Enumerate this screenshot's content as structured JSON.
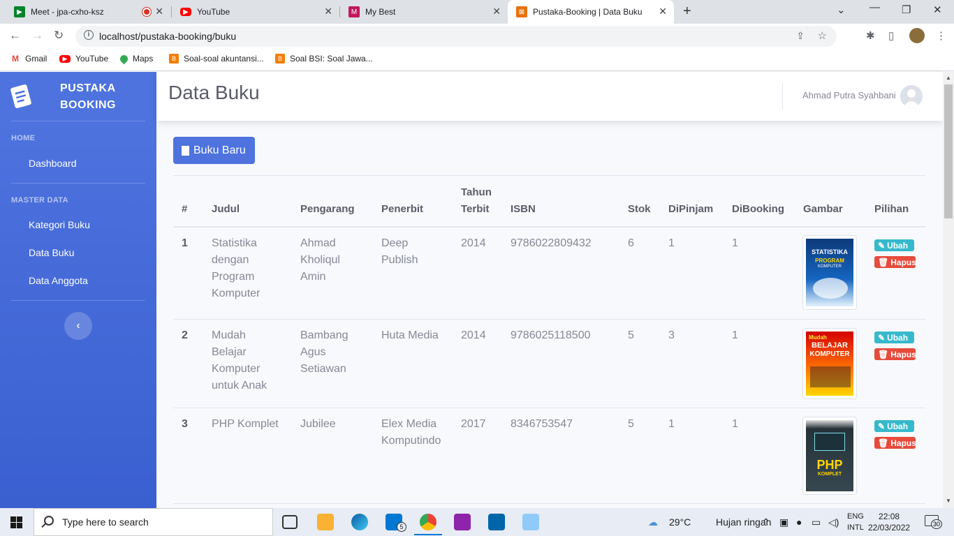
{
  "browser": {
    "tabs": [
      {
        "title": "Meet - jpa-cxho-ksz",
        "favicon": "meet-icon",
        "recording": true
      },
      {
        "title": "YouTube",
        "favicon": "youtube-icon"
      },
      {
        "title": "My Best",
        "favicon": "mybest-icon"
      },
      {
        "title": "Pustaka-Booking | Data Buku",
        "favicon": "pustaka-icon",
        "active": true
      }
    ],
    "url": "localhost/pustaka-booking/buku",
    "bookmarks": [
      {
        "label": "Gmail",
        "icon": "gmail-icon"
      },
      {
        "label": "YouTube",
        "icon": "youtube-icon"
      },
      {
        "label": "Maps",
        "icon": "maps-icon"
      },
      {
        "label": "Soal-soal akuntansi...",
        "icon": "blogger-icon"
      },
      {
        "label": "Soal BSI: Soal Jawa...",
        "icon": "blogger-icon"
      }
    ]
  },
  "sidebar": {
    "brand_line1": "PUSTAKA",
    "brand_line2": "BOOKING",
    "heading_home": "HOME",
    "item_dashboard": "Dashboard",
    "heading_master": "MASTER DATA",
    "item_kategori": "Kategori Buku",
    "item_buku": "Data Buku",
    "item_anggota": "Data Anggota",
    "toggle_icon": "chevron-left-icon"
  },
  "topbar": {
    "page_title": "Data Buku",
    "username": "Ahmad Putra Syahbani"
  },
  "content": {
    "new_button_label": "Buku Baru",
    "columns": {
      "no": "#",
      "judul": "Judul",
      "pengarang": "Pengarang",
      "penerbit": "Penerbit",
      "tahun_line1": "Tahun",
      "tahun_line2": "Terbit",
      "isbn": "ISBN",
      "stok": "Stok",
      "dipinjam": "DiPinjam",
      "dibooking": "DiBooking",
      "gambar": "Gambar",
      "pilihan": "Pilihan"
    },
    "rows": [
      {
        "no": "1",
        "judul": [
          "Statistika",
          "dengan",
          "Program",
          "Komputer"
        ],
        "pengarang": [
          "Ahmad",
          "Kholiqul",
          "Amin"
        ],
        "penerbit": [
          "Deep",
          "Publish"
        ],
        "tahun": "2014",
        "isbn": "9786022809432",
        "stok": "6",
        "dipinjam": "1",
        "dibooking": "1",
        "cover_title": "STATISTIKA",
        "cover_sub": "PROGRAM",
        "cover_sub2": "KOMPUTER"
      },
      {
        "no": "2",
        "judul": [
          "Mudah",
          "Belajar",
          "Komputer",
          "untuk Anak"
        ],
        "pengarang": [
          "Bambang",
          "Agus",
          "Setiawan"
        ],
        "penerbit": [
          "Huta Media"
        ],
        "tahun": "2014",
        "isbn": "9786025118500",
        "stok": "5",
        "dipinjam": "3",
        "dibooking": "1",
        "cover_title": "Mudah",
        "cover_sub": "BELAJAR",
        "cover_sub2": "KOMPUTER"
      },
      {
        "no": "3",
        "judul": [
          "PHP Komplet"
        ],
        "pengarang": [
          "Jubilee"
        ],
        "penerbit": [
          "Elex Media",
          "Komputindo"
        ],
        "tahun": "2017",
        "isbn": "8346753547",
        "stok": "5",
        "dipinjam": "1",
        "dibooking": "1",
        "cover_title": "PHP",
        "cover_sub": "KOMPLET",
        "cover_sub2": ""
      }
    ],
    "action_edit": "Ubah",
    "action_delete": "Hapus"
  },
  "taskbar": {
    "search_placeholder": "Type here to search",
    "weather_temp": "29°C",
    "weather_text": "Hujan ringan",
    "lang1": "ENG",
    "lang2": "INTL",
    "time": "22:08",
    "date": "22/03/2022",
    "mail_badge": "5",
    "notif_count": "30"
  }
}
